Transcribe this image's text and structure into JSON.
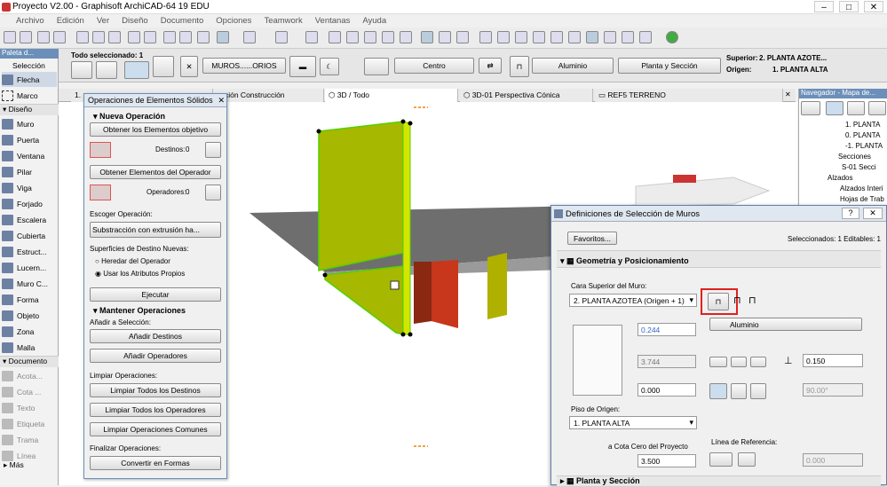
{
  "window": {
    "title": "Proyecto V2.00 - Graphisoft ArchiCAD-64 19 EDU"
  },
  "menu": [
    "Archivo",
    "Edición",
    "Ver",
    "Diseño",
    "Documento",
    "Opciones",
    "Teamwork",
    "Ventanas",
    "Ayuda"
  ],
  "infobox": {
    "selected": "Todo seleccionado: 1",
    "layer_button": "MUROS......ORIOS",
    "ref_line": "Centro",
    "material": "Aluminio",
    "plan_section": "Planta y Sección",
    "upper_label": "Superior:",
    "upper_value": "2. PLANTA AZOTE...",
    "origin_label": "Origen:",
    "origin_value": "1. PLANTA ALTA"
  },
  "palette": {
    "title": "Paleta d...",
    "selection": "Selección",
    "arrow": "Flecha",
    "marquee": "Marco",
    "design_section": "Diseño",
    "design": [
      "Muro",
      "Puerta",
      "Ventana",
      "Pilar",
      "Viga",
      "Forjado",
      "Escalera",
      "Cubierta",
      "Estruct...",
      "Lucern...",
      "Muro C...",
      "Forma",
      "Objeto",
      "Zona",
      "Malla"
    ],
    "document_section": "Documento",
    "document": [
      "Acota...",
      "Cota ...",
      "Texto",
      "Etiqueta",
      "Trama",
      "Línea"
    ],
    "more": "Más"
  },
  "tabs": [
    "1.",
    "ección Construcción",
    "3D / Todo",
    "3D-01 Perspectiva Cónica",
    "REF5 TERRENO"
  ],
  "navigator": {
    "title": "Navegador - Mapa de...",
    "items": [
      "1. PLANTA",
      "0. PLANTA",
      "-1. PLANTA",
      "Secciones",
      "S-01 Secci",
      "Alzados",
      "Alzados Interi",
      "Hojas de Trab"
    ]
  },
  "ops": {
    "title": "Operaciones de Elementos Sólidos",
    "new_op": "Nueva Operación",
    "get_targets": "Obtener los Elementos objetivo",
    "targets_label": "Destinos:",
    "targets_count": "0",
    "get_operators": "Obtener Elementos del Operador",
    "operators_label": "Operadores:",
    "operators_count": "0",
    "choose_op": "Escoger Operación:",
    "operation": "Substracción con extrusión ha...",
    "new_surfaces": "Superficies de Destino Nuevas:",
    "inherit": "Heredar del Operador",
    "own": "Usar los Atributos Propios",
    "execute": "Ejecutar",
    "keep_ops": "Mantener Operaciones",
    "add_selection": "Añadir a Selección:",
    "add_targets": "Añadir Destinos",
    "add_operators": "Añadir Operadores",
    "clear_ops": "Limpiar Operaciones:",
    "clear_targets": "Limpiar Todos los Destinos",
    "clear_operators": "Limpiar Todos los Operadores",
    "clear_common": "Limpiar Operaciones Comunes",
    "finalize": "Finalizar Operaciones:",
    "convert": "Convertir en Formas"
  },
  "dialog": {
    "title": "Definiciones de Selección de Muros",
    "favorites": "Favoritos...",
    "selected_info": "Seleccionados: 1 Editables: 1",
    "section": "Geometría y Posicionamiento",
    "top_label": "Cara Superior del Muro:",
    "top_value": "2. PLANTA AZOTEA (Origen + 1)",
    "height": "0.244",
    "height2": "3.744",
    "offset": "0.000",
    "floor_label": "Piso de Origen:",
    "floor_value": "1. PLANTA ALTA",
    "zero_label": "a Cota Cero del Proyecto",
    "zero_value": "3.500",
    "material": "Aluminio",
    "thickness": "0.150",
    "angle": "90.00°",
    "ref_line_label": "Línea de Referencia:",
    "ref_offset": "0.000",
    "bottom_section": "Planta y Sección"
  },
  "colors": {
    "accent": "#6b8fb8",
    "wall_green": "#a7b800",
    "wall_red": "#c8361b",
    "highlight": "#e02020"
  }
}
